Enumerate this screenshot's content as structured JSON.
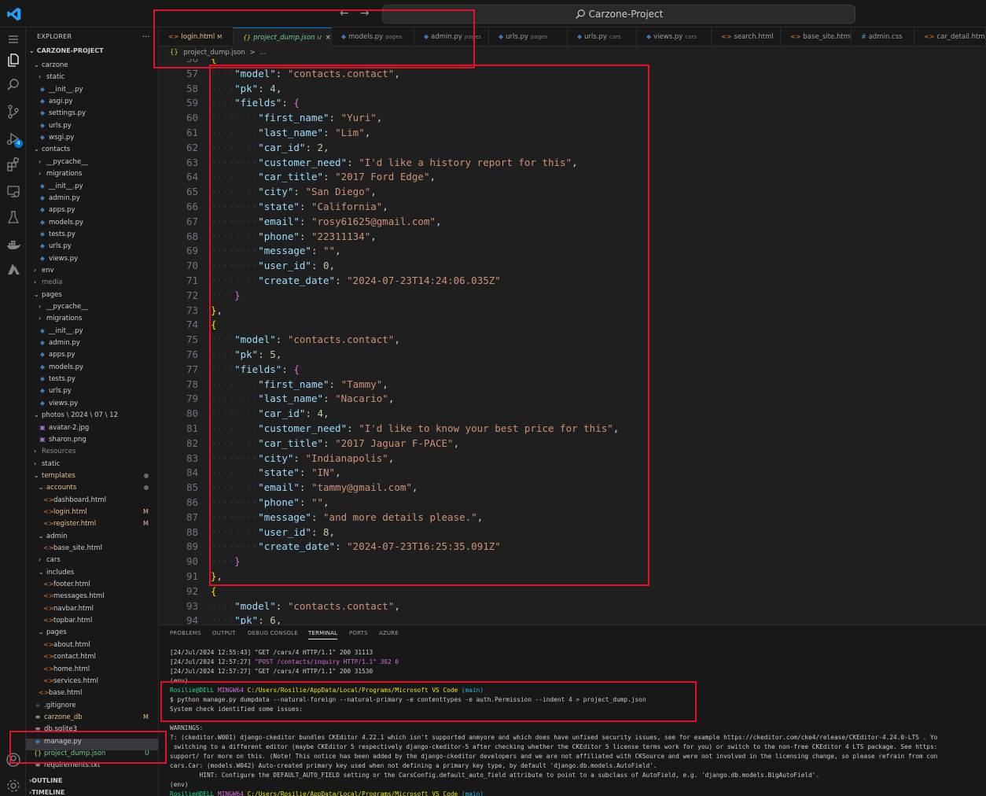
{
  "titlebar": {
    "search_label": "Carzone-Project"
  },
  "sidebar": {
    "title": "EXPLORER",
    "more": "...",
    "project": "CARZONE-PROJECT",
    "rows": [
      {
        "label": "carzone",
        "type": "folder-open",
        "indent": 0
      },
      {
        "label": "static",
        "type": "folder",
        "indent": 1
      },
      {
        "label": "__init__.py",
        "type": "py",
        "indent": 1
      },
      {
        "label": "asgi.py",
        "type": "py",
        "indent": 1
      },
      {
        "label": "settings.py",
        "type": "py",
        "indent": 1
      },
      {
        "label": "urls.py",
        "type": "py",
        "indent": 1
      },
      {
        "label": "wsgi.py",
        "type": "py",
        "indent": 1
      },
      {
        "label": "contacts",
        "type": "folder-open",
        "indent": 0
      },
      {
        "label": "__pycache__",
        "type": "folder",
        "indent": 1
      },
      {
        "label": "migrations",
        "type": "folder",
        "indent": 1
      },
      {
        "label": "__init__.py",
        "type": "py",
        "indent": 1
      },
      {
        "label": "admin.py",
        "type": "py",
        "indent": 1
      },
      {
        "label": "apps.py",
        "type": "py",
        "indent": 1
      },
      {
        "label": "models.py",
        "type": "py",
        "indent": 1
      },
      {
        "label": "tests.py",
        "type": "py",
        "indent": 1
      },
      {
        "label": "urls.py",
        "type": "py",
        "indent": 1
      },
      {
        "label": "views.py",
        "type": "py",
        "indent": 1
      },
      {
        "label": "env",
        "type": "folder",
        "indent": 0
      },
      {
        "label": "media",
        "type": "folder-dim",
        "indent": 0
      },
      {
        "label": "pages",
        "type": "folder-open",
        "indent": 0
      },
      {
        "label": "__pycache__",
        "type": "folder",
        "indent": 1
      },
      {
        "label": "migrations",
        "type": "folder",
        "indent": 1
      },
      {
        "label": "__init__.py",
        "type": "py",
        "indent": 1
      },
      {
        "label": "admin.py",
        "type": "py",
        "indent": 1
      },
      {
        "label": "apps.py",
        "type": "py",
        "indent": 1
      },
      {
        "label": "models.py",
        "type": "py",
        "indent": 1
      },
      {
        "label": "tests.py",
        "type": "py",
        "indent": 1
      },
      {
        "label": "urls.py",
        "type": "py",
        "indent": 1
      },
      {
        "label": "views.py",
        "type": "py",
        "indent": 1
      },
      {
        "label": "photos \\ 2024 \\ 07 \\ 12",
        "type": "folder-open",
        "indent": 0
      },
      {
        "label": "avatar-2.jpg",
        "type": "img",
        "indent": 1
      },
      {
        "label": "sharon.png",
        "type": "img",
        "indent": 1
      },
      {
        "label": "Resources",
        "type": "folder-dim",
        "indent": 0
      },
      {
        "label": "static",
        "type": "folder",
        "indent": 0
      },
      {
        "label": "templates",
        "type": "folder-open-mod",
        "indent": 0
      },
      {
        "label": "accounts",
        "type": "folder-open-mod",
        "indent": 1
      },
      {
        "label": "dashboard.html",
        "type": "html",
        "indent": 2
      },
      {
        "label": "login.html",
        "type": "html-mod",
        "indent": 2
      },
      {
        "label": "register.html",
        "type": "html-mod",
        "indent": 2
      },
      {
        "label": "admin",
        "type": "folder-open",
        "indent": 1
      },
      {
        "label": "base_site.html",
        "type": "html",
        "indent": 2
      },
      {
        "label": "cars",
        "type": "folder",
        "indent": 1
      },
      {
        "label": "includes",
        "type": "folder-open",
        "indent": 1
      },
      {
        "label": "footer.html",
        "type": "html",
        "indent": 2
      },
      {
        "label": "messages.html",
        "type": "html",
        "indent": 2
      },
      {
        "label": "navbar.html",
        "type": "html",
        "indent": 2
      },
      {
        "label": "topbar.html",
        "type": "html",
        "indent": 2
      },
      {
        "label": "pages",
        "type": "folder-open",
        "indent": 1
      },
      {
        "label": "about.html",
        "type": "html",
        "indent": 2
      },
      {
        "label": "contact.html",
        "type": "html",
        "indent": 2
      },
      {
        "label": "home.html",
        "type": "html",
        "indent": 2
      },
      {
        "label": "services.html",
        "type": "html",
        "indent": 2
      },
      {
        "label": "base.html",
        "type": "html",
        "indent": 1
      },
      {
        "label": ".gitignore",
        "type": "git",
        "indent": 0
      },
      {
        "label": "carzone_db",
        "type": "txt-mod",
        "indent": 0
      },
      {
        "label": "db.sqlite3",
        "type": "txt",
        "indent": 0
      },
      {
        "label": "manage.py",
        "type": "py",
        "indent": 0
      },
      {
        "label": "project_dump.json",
        "type": "json-new",
        "indent": 0
      },
      {
        "label": "requirements.txt",
        "type": "txt",
        "indent": 0
      }
    ],
    "status_m": "M",
    "status_u": "U",
    "outline": "OUTLINE",
    "timeline": "TIMELINE"
  },
  "tabs": [
    {
      "icon": "<>",
      "label": "login.html",
      "desc": "",
      "badge": "M",
      "kind": "html"
    },
    {
      "icon": "{}",
      "label": "project_dump.json",
      "desc": "",
      "badge": "U",
      "kind": "json",
      "active": true,
      "close": "×"
    },
    {
      "icon": "◆",
      "label": "models.py",
      "desc": "pages",
      "kind": "py"
    },
    {
      "icon": "◆",
      "label": "admin.py",
      "desc": "pages",
      "kind": "py"
    },
    {
      "icon": "◆",
      "label": "urls.py",
      "desc": "pages",
      "kind": "py"
    },
    {
      "icon": "◆",
      "label": "urls.py",
      "desc": "cars",
      "kind": "py"
    },
    {
      "icon": "◆",
      "label": "views.py",
      "desc": "cars",
      "kind": "py"
    },
    {
      "icon": "<>",
      "label": "search.html",
      "desc": "",
      "kind": "html"
    },
    {
      "icon": "<>",
      "label": "base_site.html",
      "desc": "",
      "kind": "html"
    },
    {
      "icon": "#",
      "label": "admin.css",
      "desc": "",
      "kind": "css"
    },
    {
      "icon": "<>",
      "label": "car_detail.htm",
      "desc": "",
      "kind": "html"
    }
  ],
  "breadcrumb": {
    "icon": "{}",
    "file": "project_dump.json",
    "sep": ">",
    "rest": "..."
  },
  "editor": {
    "lines": [
      {
        "n": "56",
        "t": "{"
      },
      {
        "n": "57",
        "t": "    \"model\": \"contacts.contact\","
      },
      {
        "n": "58",
        "t": "    \"pk\": 4,"
      },
      {
        "n": "59",
        "t": "    \"fields\": {"
      },
      {
        "n": "60",
        "t": "        \"first_name\": \"Yuri\","
      },
      {
        "n": "61",
        "t": "        \"last_name\": \"Lim\","
      },
      {
        "n": "62",
        "t": "        \"car_id\": 2,"
      },
      {
        "n": "63",
        "t": "        \"customer_need\": \"I'd like a history report for this\","
      },
      {
        "n": "64",
        "t": "        \"car_title\": \"2017 Ford Edge\","
      },
      {
        "n": "65",
        "t": "        \"city\": \"San Diego\","
      },
      {
        "n": "66",
        "t": "        \"state\": \"California\","
      },
      {
        "n": "67",
        "t": "        \"email\": \"rosy61625@gmail.com\","
      },
      {
        "n": "68",
        "t": "        \"phone\": \"22311134\","
      },
      {
        "n": "69",
        "t": "        \"message\": \"\","
      },
      {
        "n": "70",
        "t": "        \"user_id\": 0,"
      },
      {
        "n": "71",
        "t": "        \"create_date\": \"2024-07-23T14:24:06.035Z\""
      },
      {
        "n": "72",
        "t": "    }"
      },
      {
        "n": "73",
        "t": "},"
      },
      {
        "n": "74",
        "t": "{"
      },
      {
        "n": "75",
        "t": "    \"model\": \"contacts.contact\","
      },
      {
        "n": "76",
        "t": "    \"pk\": 5,"
      },
      {
        "n": "77",
        "t": "    \"fields\": {"
      },
      {
        "n": "78",
        "t": "        \"first_name\": \"Tammy\","
      },
      {
        "n": "79",
        "t": "        \"last_name\": \"Nacario\","
      },
      {
        "n": "80",
        "t": "        \"car_id\": 4,"
      },
      {
        "n": "81",
        "t": "        \"customer_need\": \"I'd like to know your best price for this\","
      },
      {
        "n": "82",
        "t": "        \"car_title\": \"2017 Jaguar F-PACE\","
      },
      {
        "n": "83",
        "t": "        \"city\": \"Indianapolis\","
      },
      {
        "n": "84",
        "t": "        \"state\": \"IN\","
      },
      {
        "n": "85",
        "t": "        \"email\": \"tammy@gmail.com\","
      },
      {
        "n": "86",
        "t": "        \"phone\": \"\","
      },
      {
        "n": "87",
        "t": "        \"message\": \"and more details please.\","
      },
      {
        "n": "88",
        "t": "        \"user_id\": 8,"
      },
      {
        "n": "89",
        "t": "        \"create_date\": \"2024-07-23T16:25:35.091Z\""
      },
      {
        "n": "90",
        "t": "    }"
      },
      {
        "n": "91",
        "t": "},"
      },
      {
        "n": "92",
        "t": "{"
      },
      {
        "n": "93",
        "t": "    \"model\": \"contacts.contact\","
      },
      {
        "n": "94",
        "t": "    \"pk\": 6,"
      }
    ]
  },
  "panel": {
    "tabs": [
      "PROBLEMS",
      "OUTPUT",
      "DEBUG CONSOLE",
      "TERMINAL",
      "PORTS",
      "AZURE"
    ],
    "active_tab": "TERMINAL",
    "log1_time": "[24/Jul/2024 12:55:43]",
    "log1_req": " \"GET /cars/4 HTTP/1.1\" 200 31113",
    "log2_time": "[24/Jul/2024 12:57:27]",
    "log2_req": " \"POST /contacts/inquiry HTTP/1.1\" 302 0",
    "log3_time": "[24/Jul/2024 12:57:27]",
    "log3_req": " \"GET /cars/4 HTTP/1.1\" 200 31530",
    "env1": "(env)",
    "prompt_user": "Rosilie@DELL",
    "prompt_sys": "MINGW64",
    "prompt_path": "C:/Users/Rosilie/AppData/Local/Programs/Microsoft VS Code",
    "prompt_branch": "(main)",
    "command": "$ python manage.py dumpdata --natural-foreign --natural-primary -e contenttypes -e auth.Permission --indent 4 > project_dump.json",
    "check": "System check identified some issues:",
    "warnings_hdr": "WARNINGS:",
    "warn1": "?: (ckeditor.W001) django-ckeditor bundles CKEditor 4.22.1 which isn't supported anmyore and which does have unfixed security issues, see for example https://ckeditor.com/cke4/release/CKEditor-4.24.0-LTS . Yo",
    "warn2": " switching to a different editor (maybe CKEditor 5 respectively django-ckeditor-5 after checking whether the CKEditor 5 license terms work for you) or switch to the non-free CKEditor 4 LTS package. See https:",
    "warn3": "support/ for more on this. (Note! This notice has been added by the django-ckeditor developers and we are not affiliated with CKSource and were not involved in the licensing change, so please refrain from con",
    "warn4": "cars.Car: (models.W042) Auto-created primary key used when not defining a primary key type, by default 'django.db.models.AutoField'.",
    "warn5": "        HINT: Configure the DEFAULT_AUTO_FIELD setting or the CarsConfig.default_auto_field attribute to point to a subclass of AutoField, e.g. 'django.db.models.BigAutoField'.",
    "blank": "",
    "env2": "(env)"
  },
  "colors": {
    "annotation": "#e3102a",
    "accent": "#0078d4"
  }
}
